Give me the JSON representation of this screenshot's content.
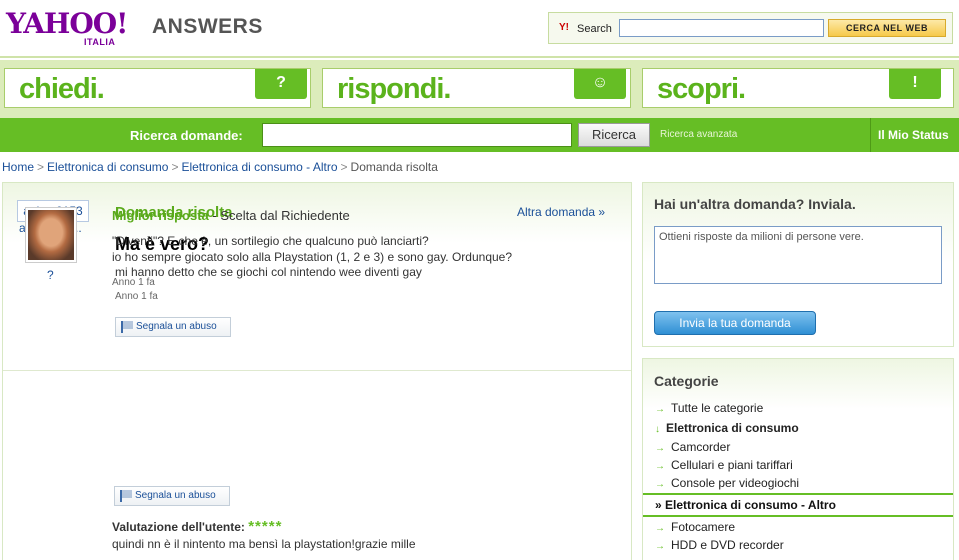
{
  "header": {
    "logo": "YAHOO!",
    "logo_sub": "ITALIA",
    "product": "ANSWERS",
    "search_label": "Search",
    "search_button": "CERCA NEL WEB",
    "search_value": ""
  },
  "tabs": [
    {
      "label": "chiedi.",
      "icon": "?"
    },
    {
      "label": "rispondi.",
      "icon": "☺"
    },
    {
      "label": "scopri.",
      "icon": "!"
    }
  ],
  "search_bar": {
    "label": "Ricerca domande:",
    "button": "Ricerca",
    "advanced": "Ricerca avanzata",
    "status": "Il Mio Status"
  },
  "breadcrumb": [
    "Home",
    "Elettronica di consumo",
    "Elettronica di consumo - Altro",
    "Domanda risolta"
  ],
  "question": {
    "user": "anima0153",
    "user2": "anima015...",
    "status": "Domanda risolta",
    "other": "Altra domanda",
    "other_icon": "»",
    "title": "Ma è vero?",
    "body": "mi hanno detto che se giochi col nintendo wee diventi gay",
    "time": "Anno 1 fa",
    "report": "Segnala un abuso"
  },
  "best_answer": {
    "heading": "Miglior risposta",
    "chosen_by": "- Scelta dal Richiedente",
    "avatar_label": "?",
    "body_line1": "\"Diventi\"? E che è, un sortilegio che qualcuno può lanciarti?",
    "body_line2": "io ho sempre giocato solo alla Playstation (1, 2 e 3) e sono gay. Ordunque?",
    "time": "Anno 1 fa",
    "report": "Segnala un abuso",
    "rating_label": "Valutazione dell'utente:",
    "rating_stars": "*****",
    "rating_value": 5,
    "rating_comment": "quindi nn è il nintento ma bensì la playstation!grazie mille"
  },
  "ask": {
    "title": "Hai un'altra domanda? Inviala.",
    "placeholder": "Ottieni risposte da milioni di persone vere.",
    "button": "Invia la tua domanda"
  },
  "categories": {
    "title": "Categorie",
    "items": [
      {
        "label": "Tutte le categorie",
        "arrow": "→",
        "bold": false
      },
      {
        "label": "Elettronica di consumo",
        "arrow": "↓",
        "bold": true
      },
      {
        "label": "Camcorder",
        "arrow": "→",
        "bold": false
      },
      {
        "label": "Cellulari e piani tariffari",
        "arrow": "→",
        "bold": false
      },
      {
        "label": "Console per videogiochi",
        "arrow": "→",
        "bold": false
      }
    ],
    "selected": "» Elettronica di consumo - Altro",
    "items_after": [
      {
        "label": "Fotocamere",
        "arrow": "→"
      },
      {
        "label": "HDD e DVD recorder",
        "arrow": "→"
      }
    ]
  },
  "colors": {
    "brand_purple": "#7b0099",
    "accent_green": "#66be25",
    "link_blue": "#1a4f98"
  }
}
